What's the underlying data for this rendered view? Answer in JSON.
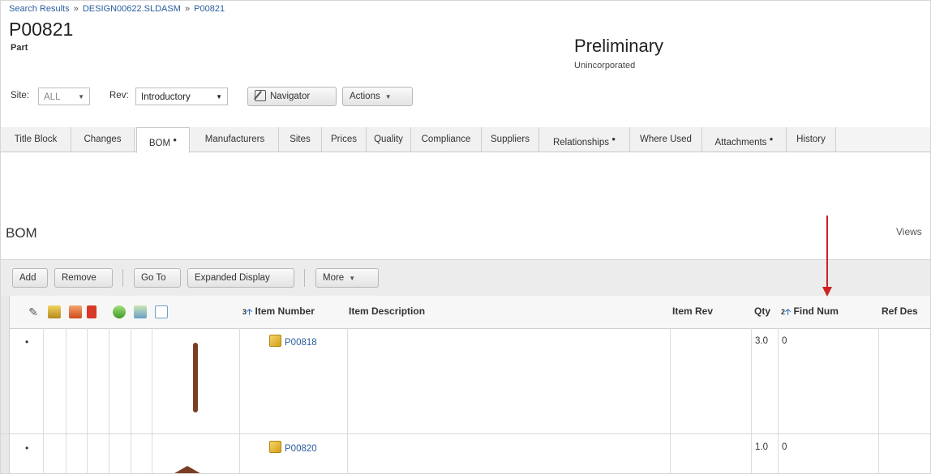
{
  "breadcrumb": {
    "items": [
      "Search Results",
      "DESIGN00622.SLDASM",
      "P00821"
    ],
    "separator": "»"
  },
  "object": {
    "id": "P00821",
    "type": "Part",
    "status": "Preliminary",
    "workflow": "Unincorporated"
  },
  "controls": {
    "site_label": "Site:",
    "site_value": "ALL",
    "rev_label": "Rev:",
    "rev_value": "Introductory",
    "navigator_label": "Navigator",
    "actions_label": "Actions"
  },
  "tabs": [
    {
      "label": "Title Block",
      "dot": ""
    },
    {
      "label": "Changes",
      "dot": ""
    },
    {
      "label": "BOM",
      "dot": "●"
    },
    {
      "label": "Manufacturers",
      "dot": ""
    },
    {
      "label": "Sites",
      "dot": ""
    },
    {
      "label": "Prices",
      "dot": ""
    },
    {
      "label": "Quality",
      "dot": ""
    },
    {
      "label": "Compliance",
      "dot": ""
    },
    {
      "label": "Suppliers",
      "dot": ""
    },
    {
      "label": "Relationships",
      "dot": "●"
    },
    {
      "label": "Where Used",
      "dot": ""
    },
    {
      "label": "Attachments",
      "dot": "●"
    },
    {
      "label": "History",
      "dot": ""
    }
  ],
  "active_tab": "BOM",
  "bom": {
    "title": "BOM",
    "views_label": "Views",
    "toolbar": {
      "add": "Add",
      "remove": "Remove",
      "go_to": "Go To",
      "expanded_display": "Expanded Display",
      "more": "More"
    },
    "columns": {
      "item_number": {
        "sort": "3",
        "label": "Item Number"
      },
      "item_description": "Item Description",
      "item_rev": "Item Rev",
      "qty": "Qty",
      "find_num": {
        "sort": "2",
        "label": "Find Num"
      },
      "ref_des": "Ref Des"
    },
    "header_icons": [
      "paperclip-icon",
      "stack-icon",
      "edit-icon",
      "redline-icon",
      "compare-icon",
      "refresh-icon",
      "doc-icon"
    ],
    "rows": [
      {
        "bullet": "•",
        "item_number": "P00818",
        "qty": "3.0",
        "find_num": "0"
      },
      {
        "bullet": "•",
        "item_number": "P00820",
        "qty": "1.0",
        "find_num": "0"
      }
    ]
  },
  "colors": {
    "link": "#2a5d9c",
    "annotation_arrow": "#cc2222",
    "sort_arrow": "#2a6bc2"
  }
}
